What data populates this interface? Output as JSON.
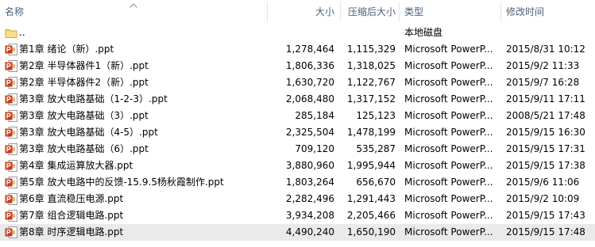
{
  "header": {
    "name": "名称",
    "size": "大小",
    "compressed": "压缩后大小",
    "type": "类型",
    "modified": "修改时间"
  },
  "rows": [
    {
      "icon": "folder-icon",
      "name": "..",
      "size": "",
      "compressed": "",
      "type": "本地磁盘",
      "modified": ""
    },
    {
      "icon": "powerpoint-file-icon",
      "name": "第1章 绪论（新）.ppt",
      "size": "1,278,464",
      "compressed": "1,115,329",
      "type": "Microsoft PowerP...",
      "modified": "2015/8/31 10:12"
    },
    {
      "icon": "powerpoint-file-icon",
      "name": "第2章 半导体器件1（新）.ppt",
      "size": "1,806,336",
      "compressed": "1,318,025",
      "type": "Microsoft PowerP...",
      "modified": "2015/9/2 11:33"
    },
    {
      "icon": "powerpoint-file-icon",
      "name": "第2章 半导体器件2（新）.ppt",
      "size": "1,630,720",
      "compressed": "1,122,767",
      "type": "Microsoft PowerP...",
      "modified": "2015/9/7 16:28"
    },
    {
      "icon": "powerpoint-file-icon",
      "name": "第3章 放大电路基础（1-2-3）.ppt",
      "size": "2,068,480",
      "compressed": "1,317,152",
      "type": "Microsoft PowerP...",
      "modified": "2015/9/11 17:11"
    },
    {
      "icon": "powerpoint-file-icon",
      "name": "第3章 放大电路基础（3）.ppt",
      "size": "285,184",
      "compressed": "125,123",
      "type": "Microsoft PowerP...",
      "modified": "2008/5/21 17:48"
    },
    {
      "icon": "powerpoint-file-icon",
      "name": "第3章 放大电路基础（4-5）.ppt",
      "size": "2,325,504",
      "compressed": "1,478,199",
      "type": "Microsoft PowerP...",
      "modified": "2015/9/15 16:30"
    },
    {
      "icon": "powerpoint-file-icon",
      "name": "第3章 放大电路基础（6）.ppt",
      "size": "709,120",
      "compressed": "535,287",
      "type": "Microsoft PowerP...",
      "modified": "2015/9/15 17:31"
    },
    {
      "icon": "powerpoint-file-icon",
      "name": "第4章 集成运算放大器.ppt",
      "size": "3,880,960",
      "compressed": "1,995,944",
      "type": "Microsoft PowerP...",
      "modified": "2015/9/15 17:38"
    },
    {
      "icon": "powerpoint-file-icon",
      "name": "第5章 放大电路中的反馈-15.9.5杨秋霞制作.ppt",
      "size": "1,803,264",
      "compressed": "656,670",
      "type": "Microsoft PowerP...",
      "modified": "2015/9/6 11:06"
    },
    {
      "icon": "powerpoint-file-icon",
      "name": "第6章 直流稳压电源.ppt",
      "size": "2,282,496",
      "compressed": "1,291,443",
      "type": "Microsoft PowerP...",
      "modified": "2015/9/2 10:09"
    },
    {
      "icon": "powerpoint-file-icon",
      "name": "第7章 组合逻辑电路.ppt",
      "size": "3,934,208",
      "compressed": "2,205,466",
      "type": "Microsoft PowerP...",
      "modified": "2015/9/15 17:43"
    },
    {
      "icon": "powerpoint-file-icon",
      "name": "第8章 时序逻辑电路.ppt",
      "size": "4,490,240",
      "compressed": "1,650,190",
      "type": "Microsoft PowerP...",
      "modified": "2015/9/15 17:48",
      "selected": true
    }
  ]
}
